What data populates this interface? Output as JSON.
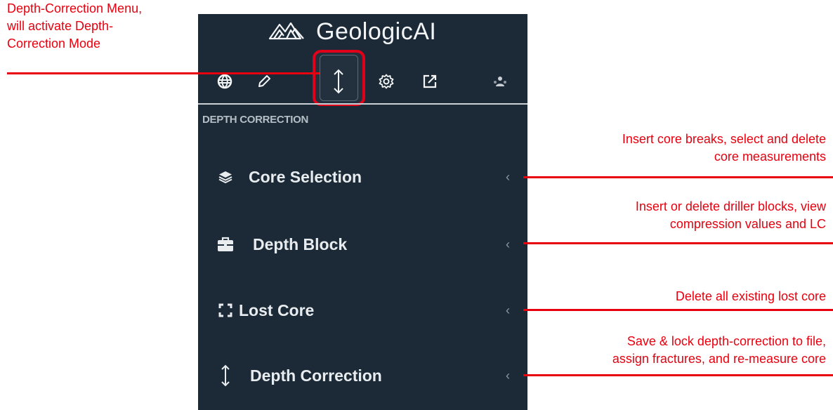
{
  "app": {
    "brand": "GeologicAI"
  },
  "toolbar": {
    "icons": [
      "globe-icon",
      "pencil-icon",
      "depth-correction-icon",
      "settings-icon",
      "external-link-icon",
      "user-group-icon"
    ]
  },
  "sidebar": {
    "section_title": "DEPTH CORRECTION",
    "items": [
      {
        "label": "Core Selection",
        "icon": "layers-icon",
        "chevron": "‹"
      },
      {
        "label": "Depth Block",
        "icon": "toolbox-icon",
        "chevron": "‹"
      },
      {
        "label": "Lost Core",
        "icon": "frame-corners-icon",
        "chevron": "‹"
      },
      {
        "label": "Depth Correction",
        "icon": "vertical-arrows-icon",
        "chevron": "‹"
      }
    ]
  },
  "annotations": {
    "menu": [
      "Depth-Correction Menu,",
      "will activate Depth-",
      "Correction Mode"
    ],
    "core_selection": [
      "Insert core breaks, select and delete",
      "core measurements"
    ],
    "depth_block": [
      "Insert or delete driller blocks, view",
      "compression values and LC"
    ],
    "lost_core": [
      "Delete all existing lost core"
    ],
    "depth_correction": [
      "Save & lock depth-correction to file,",
      "assign fractures, and re-measure core"
    ]
  },
  "colors": {
    "panel_bg": "#1b2a36",
    "annotation_red": "#e8000f",
    "text_light": "#e8ecef"
  }
}
